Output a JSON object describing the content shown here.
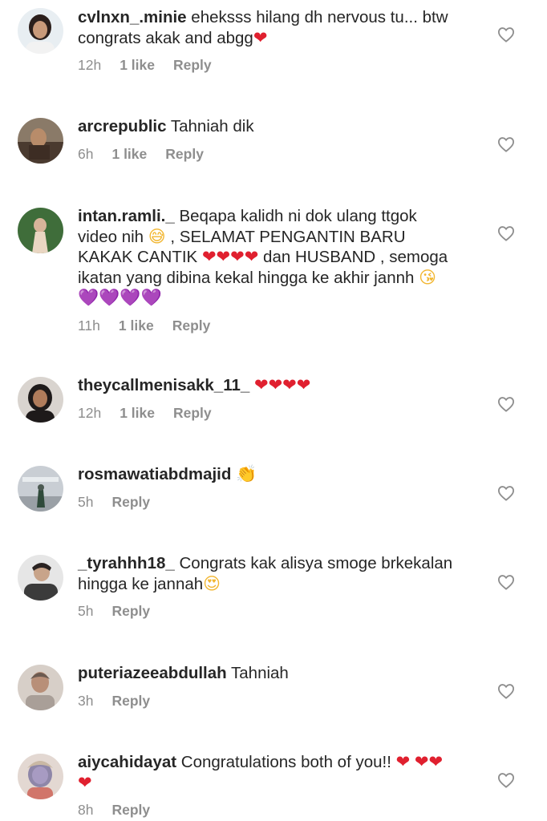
{
  "comments": [
    {
      "username": "cvlnxn_.minie",
      "text": "eheksss hilang dh nervous tu... btw congrats akak and abgg",
      "emojis": "❤",
      "time": "12h",
      "likes": "1 like",
      "reply": "Reply"
    },
    {
      "username": "arcrepublic",
      "text": "Tahniah dik",
      "emojis": "",
      "time": "6h",
      "likes": "1 like",
      "reply": "Reply"
    },
    {
      "username": "intan.ramli._",
      "text": "Beqapa kalidh ni dok ulang ttgok video nih",
      "emoji_sweat": "😅",
      "text2": ", SELAMAT PENGANTIN BARU KAKAK CANTIK",
      "emojis_red": "❤❤❤❤",
      "text3": "dan HUSBAND , semoga ikatan yang dibina kekal hingga ke akhir jannh",
      "emoji_kiss": "😘",
      "emojis_purple": "💜💜💜💜",
      "time": "11h",
      "likes": "1 like",
      "reply": "Reply"
    },
    {
      "username": "theycallmenisakk_11_",
      "text": "",
      "emojis": "❤❤❤❤",
      "time": "12h",
      "likes": "1 like",
      "reply": "Reply"
    },
    {
      "username": "rosmawatiabdmajid",
      "text": "",
      "emojis": "👏",
      "time": "5h",
      "likes": "",
      "reply": "Reply"
    },
    {
      "username": "_tyrahhh18_",
      "text": "Congrats kak alisya smoge brkekalan hingga ke jannah",
      "emojis": "😍",
      "time": "5h",
      "likes": "",
      "reply": "Reply"
    },
    {
      "username": "puteriazeeabdullah",
      "text": "Tahniah",
      "emojis": "",
      "time": "3h",
      "likes": "",
      "reply": "Reply"
    },
    {
      "username": "aiycahidayat",
      "text": "Congratulations both of you!!",
      "emojis": "❤",
      "emojis2": "❤❤❤",
      "time": "8h",
      "likes": "",
      "reply": "Reply"
    }
  ],
  "icons": {
    "like": "heart-outline-icon"
  },
  "colors": {
    "text": "#262626",
    "meta": "#8e8e8e",
    "heart_red": "#e0202f",
    "heart_purple": "#9b3be5"
  }
}
